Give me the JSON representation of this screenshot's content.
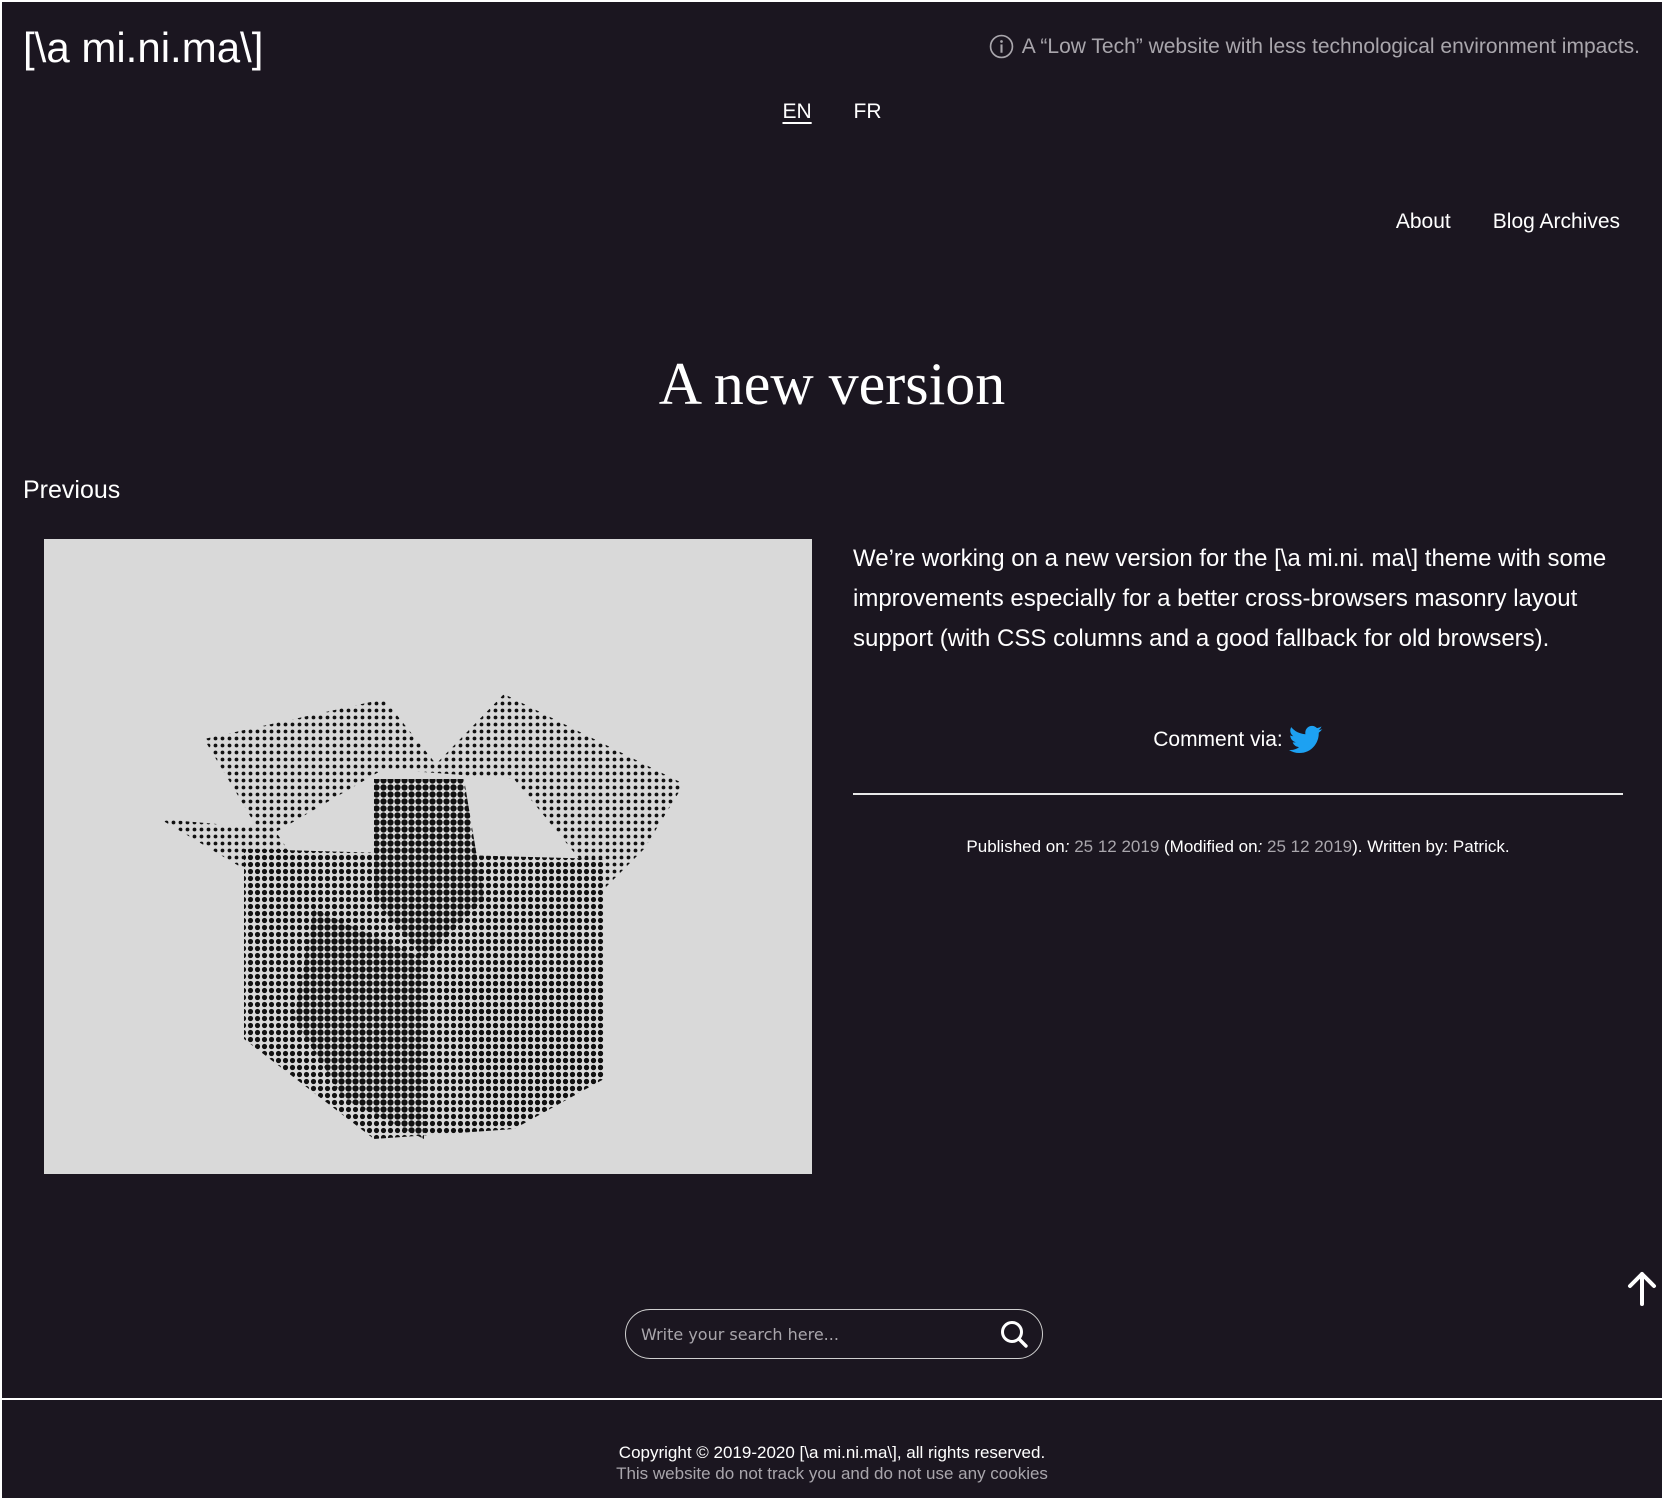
{
  "site": {
    "logo": "[\\a mi.ni.ma\\]",
    "tagline": "A “Low Tech” website with less technological environment impacts."
  },
  "lang": {
    "en": "EN",
    "fr": "FR",
    "active": "EN"
  },
  "nav": {
    "about": "About",
    "archives": "Blog Archives"
  },
  "post": {
    "title": "A new version",
    "previous": "Previous",
    "body": "We’re working on a new version for the [\\a mi.ni. ma\\] theme with some improvements especially for a better cross-browsers masonry layout support (with CSS columns and a good fallback for old browsers).",
    "comment_label": "Comment via:",
    "published_label": "Published on",
    "published_date": "25 12 2019",
    "modified_label": "(Modified on",
    "modified_date": "25 12 2019",
    "written_label": "). Written by: Patrick."
  },
  "search": {
    "placeholder": "Write your search here..."
  },
  "footer": {
    "copyright": "Copyright © 2019-2020 [\\a mi.ni.ma\\], all rights reserved.",
    "notrack": "This website do not track you and do not use any cookies"
  },
  "colors": {
    "background": "#1b1620",
    "muted": "#a9a6ac",
    "twitter": "#1da1f2",
    "image_bg": "#d9d9d9"
  },
  "icons": [
    "info-icon",
    "twitter-icon",
    "arrow-up-icon",
    "search-icon"
  ]
}
